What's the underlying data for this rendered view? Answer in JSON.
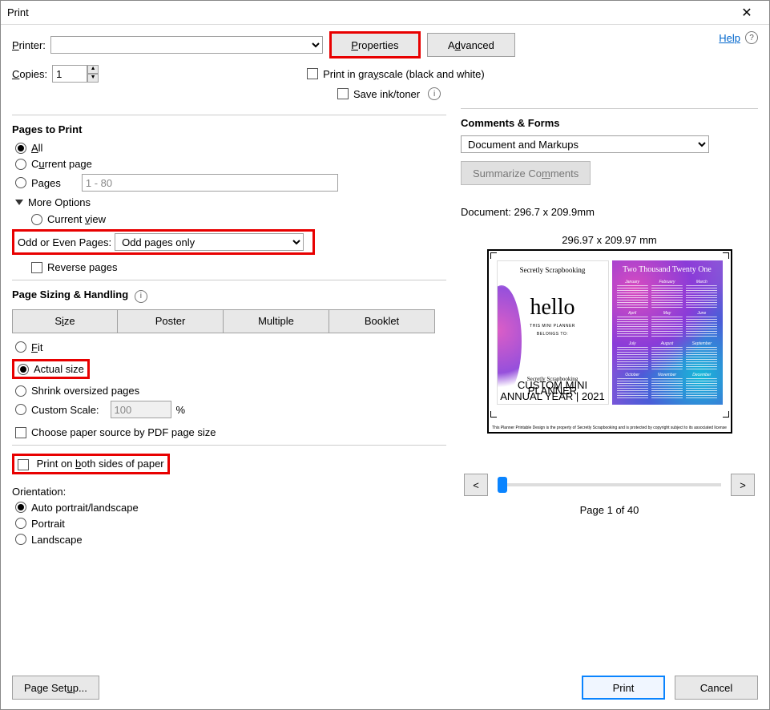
{
  "title": "Print",
  "help": "Help",
  "printer": {
    "label": "Printer:",
    "value": ""
  },
  "properties_btn": "Properties",
  "advanced_btn": "Advanced",
  "copies": {
    "label": "Copies:",
    "value": "1"
  },
  "grayscale_label": "Print in grayscale (black and white)",
  "save_ink_label": "Save ink/toner",
  "pages_to_print": {
    "title": "Pages to Print",
    "all": "All",
    "current": "Current page",
    "pages": "Pages",
    "pages_value": "1 - 80",
    "more_options": "More Options",
    "current_view": "Current view",
    "odd_even_label": "Odd or Even Pages:",
    "odd_even_value": "Odd pages only",
    "reverse": "Reverse pages"
  },
  "sizing": {
    "title": "Page Sizing & Handling",
    "size": "Size",
    "poster": "Poster",
    "multiple": "Multiple",
    "booklet": "Booklet",
    "fit": "Fit",
    "actual": "Actual size",
    "shrink": "Shrink oversized pages",
    "custom": "Custom Scale:",
    "custom_value": "100",
    "percent": "%",
    "choose_source": "Choose paper source by PDF page size"
  },
  "both_sides": "Print on both sides of paper",
  "orientation": {
    "title": "Orientation:",
    "auto": "Auto portrait/landscape",
    "portrait": "Portrait",
    "landscape": "Landscape"
  },
  "comments": {
    "title": "Comments & Forms",
    "value": "Document and Markups",
    "summarize": "Summarize Comments"
  },
  "document_dims": "Document: 296.7 x 209.9mm",
  "preview": {
    "size_label": "296.97 x 209.97 mm",
    "brand": "Secretly Scrapbooking",
    "hello": "hello",
    "sub1": "THIS MINI PLANNER",
    "sub2": "BELONGS TO:",
    "foot_brand": "Secretly Scrapbooking",
    "foot_line1": "CUSTOM MINI PLANNER",
    "foot_line2": "ANNUAL YEAR | 2021",
    "cal_title": "Two Thousand Twenty One",
    "months": [
      "January",
      "February",
      "March",
      "April",
      "May",
      "June",
      "July",
      "August",
      "September",
      "October",
      "November",
      "December"
    ],
    "caption": "This Planner Printable Design is the property of Secretly Scrapbooking and is protected by copyright subject to its associated license"
  },
  "pager": {
    "prev": "<",
    "next": ">",
    "label": "Page 1 of 40"
  },
  "page_setup": "Page Setup...",
  "print_btn": "Print",
  "cancel_btn": "Cancel"
}
